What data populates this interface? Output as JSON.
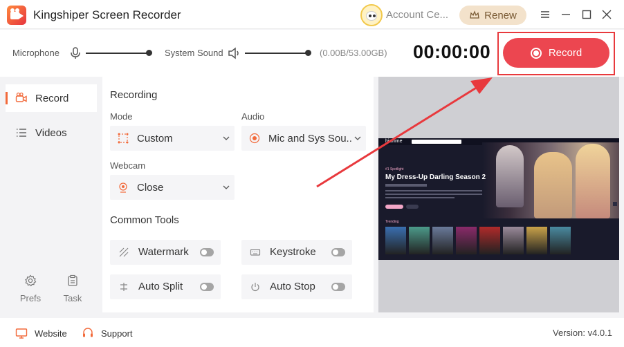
{
  "app": {
    "title": "Kingshiper Screen Recorder",
    "account_label": "Account Ce...",
    "renew_label": "Renew",
    "accent_color": "#ec4650"
  },
  "controls": {
    "microphone_label": "Microphone",
    "system_sound_label": "System Sound",
    "storage_text": "(0.00B/53.00GB)",
    "timer": "00:00:00",
    "record_label": "Record"
  },
  "sidebar": {
    "items": [
      {
        "label": "Record",
        "icon": "camera-icon",
        "active": true
      },
      {
        "label": "Videos",
        "icon": "list-icon",
        "active": false
      }
    ],
    "bottom": [
      {
        "label": "Prefs",
        "icon": "gear-icon"
      },
      {
        "label": "Task",
        "icon": "clipboard-icon"
      }
    ]
  },
  "recording": {
    "section_title": "Recording",
    "mode_label": "Mode",
    "mode_value": "Custom",
    "audio_label": "Audio",
    "audio_value": "Mic and Sys Sou...",
    "webcam_label": "Webcam",
    "webcam_value": "Close"
  },
  "tools": {
    "section_title": "Common Tools",
    "items": [
      {
        "label": "Watermark",
        "icon": "watermark-icon",
        "enabled": false
      },
      {
        "label": "Keystroke",
        "icon": "keyboard-icon",
        "enabled": false
      },
      {
        "label": "Auto Split",
        "icon": "split-icon",
        "enabled": false
      },
      {
        "label": "Auto Stop",
        "icon": "power-icon",
        "enabled": false
      }
    ]
  },
  "preview": {
    "site_logo": "hianime",
    "spotlight_tag": "#1 Spotlight",
    "headline": "My Dress-Up Darling Season 2",
    "trending_label": "Trending",
    "poster_colors": [
      "#3a6fb0",
      "#4c9a8a",
      "#6a7a9a",
      "#8a2a6a",
      "#b02a2a",
      "#9a8a9a",
      "#c9a24a",
      "#4a8aa0"
    ]
  },
  "footer": {
    "website_label": "Website",
    "support_label": "Support",
    "version": "Version: v4.0.1"
  }
}
